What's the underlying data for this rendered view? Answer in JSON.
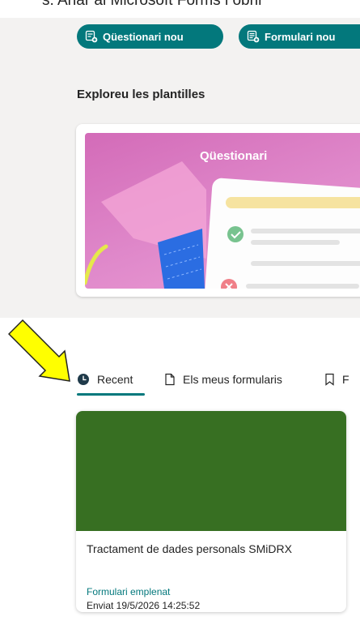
{
  "top_text": "s. Anar al Microsoft Forms i obrir",
  "actions": {
    "new_quiz_label": "Qüestionari nou",
    "new_form_label": "Formulari nou"
  },
  "templates": {
    "title": "Exploreu les plantilles",
    "items": [
      {
        "label": "Qüestionari"
      }
    ]
  },
  "tabs": [
    {
      "label": "Recent",
      "active": true
    },
    {
      "label": "Els meus formularis",
      "active": false
    },
    {
      "label": "F",
      "active": false
    }
  ],
  "recent_forms": [
    {
      "title": "Tractament de dades personals SMiDRX",
      "status": "Formulari emplenat",
      "submitted": "Enviat 19/5/2026 14:25:52",
      "cover_color": "#376f22"
    }
  ],
  "colors": {
    "accent": "#03787c",
    "annotation_arrow": "#ffff00"
  }
}
